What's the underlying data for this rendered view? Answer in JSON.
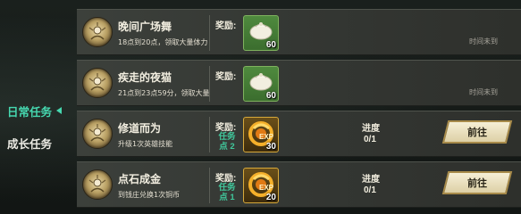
{
  "sidebar": {
    "tabs": [
      {
        "label": "日常任务",
        "active": true
      },
      {
        "label": "成长任务",
        "active": false
      }
    ]
  },
  "reward_label": "奖励:",
  "progress_label": "进度",
  "go_label": "前往",
  "tasks": [
    {
      "title": "晚间广场舞",
      "desc": "18点到20点，领取大量体力",
      "reward_icon": "bun-icon",
      "reward_qty": "60",
      "status": "时间未到"
    },
    {
      "title": "疾走的夜猫",
      "desc": "21点到23点59分，领取大量",
      "reward_icon": "bun-icon",
      "reward_qty": "60",
      "status": "时间未到"
    },
    {
      "title": "修道而为",
      "desc": "升级1次英雄技能",
      "reward_sub": "任务点 2",
      "reward_icon": "exp-icon",
      "reward_qty": "30",
      "progress": "0/1"
    },
    {
      "title": "点石成金",
      "desc": "到钱庄兑换1次铜币",
      "reward_sub": "任务点 1",
      "reward_icon": "exp-icon",
      "reward_qty": "20",
      "progress": "0/1"
    }
  ]
}
